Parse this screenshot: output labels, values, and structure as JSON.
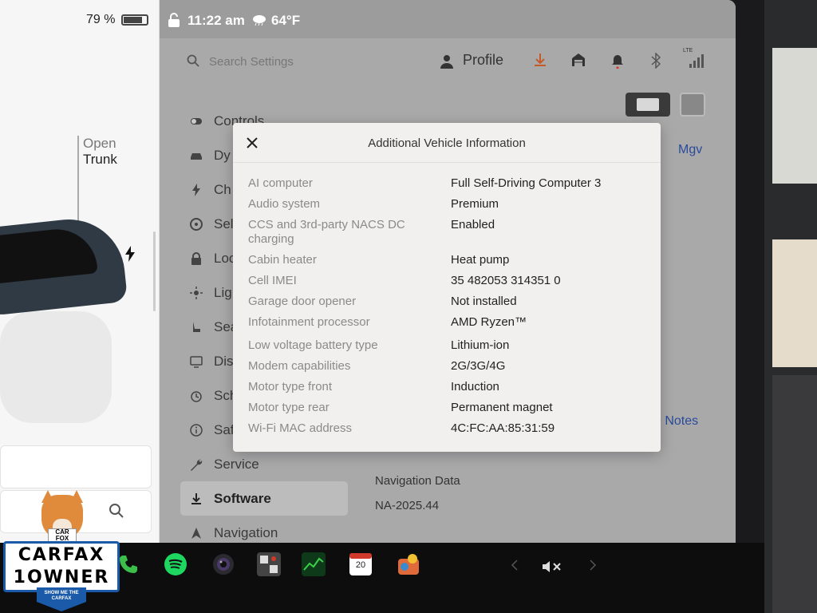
{
  "status": {
    "battery_percent_text": "79 %",
    "battery_level": 0.79,
    "time": "11:22 am",
    "temperature": "64°F",
    "weather_icon": "cloud-rain-icon"
  },
  "car_panel": {
    "open_label": "Open",
    "trunk_label": "Trunk"
  },
  "header": {
    "search_placeholder": "Search Settings",
    "profile_label": "Profile",
    "lte_label": "LTE"
  },
  "menu": {
    "items": [
      {
        "label": "Controls",
        "icon": "toggle-icon"
      },
      {
        "label": "Dy",
        "icon": "car-icon"
      },
      {
        "label": "Ch",
        "icon": "bolt-icon"
      },
      {
        "label": "Sel",
        "icon": "steering-wheel-icon"
      },
      {
        "label": "Loc",
        "icon": "lock-icon"
      },
      {
        "label": "Lig",
        "icon": "sun-icon"
      },
      {
        "label": "Sea",
        "icon": "seat-icon"
      },
      {
        "label": "Dis",
        "icon": "display-icon"
      },
      {
        "label": "Sch",
        "icon": "clock-icon"
      },
      {
        "label": "Saf",
        "icon": "info-icon"
      },
      {
        "label": "Service",
        "icon": "wrench-icon"
      },
      {
        "label": "Software",
        "icon": "download-icon"
      },
      {
        "label": "Navigation",
        "icon": "navigation-icon"
      }
    ],
    "active_index": 11
  },
  "background_content": {
    "mgv": "Mgv",
    "release_notes": "e Notes",
    "navigation_data_label": "Navigation Data",
    "navigation_data_value": "NA-2025.44"
  },
  "modal": {
    "title": "Additional Vehicle Information",
    "rows": [
      {
        "label": "AI computer",
        "value": "Full Self-Driving Computer 3"
      },
      {
        "label": "Audio system",
        "value": "Premium"
      },
      {
        "label": "CCS and 3rd-party NACS DC charging",
        "value": "Enabled"
      },
      {
        "label": "Cabin heater",
        "value": "Heat pump"
      },
      {
        "label": "Cell IMEI",
        "value": "35 482053 314351 0"
      },
      {
        "label": "Garage door opener",
        "value": "Not installed"
      },
      {
        "label": "Infotainment processor",
        "value": "AMD Ryzen™"
      },
      {
        "label": "Low voltage battery type",
        "value": "Lithium-ion"
      },
      {
        "label": "Modem capabilities",
        "value": "2G/3G/4G"
      },
      {
        "label": "Motor type front",
        "value": "Induction"
      },
      {
        "label": "Motor type rear",
        "value": "Permanent magnet"
      },
      {
        "label": "Wi-Fi MAC address",
        "value": "4C:FC:AA:85:31:59"
      }
    ]
  },
  "dock": {
    "calendar_day": "20",
    "apps": [
      "phone-icon",
      "spotify-icon",
      "camera-icon",
      "arcade-icon",
      "stocks-icon",
      "calendar-icon",
      "toybox-icon"
    ]
  },
  "carfax": {
    "shirt_line1": "CAR",
    "shirt_line2": "FOX",
    "line1": "CARFAX",
    "line2": "1OWNER",
    "ribbon_line1": "SHOW ME THE",
    "ribbon_line2": "CARFAX"
  },
  "colors": {
    "link": "#2a4a9a",
    "modal_bg": "#f1f0ee",
    "dim_overlay": "#a9a9aa",
    "carfax_blue": "#1a5aa8"
  }
}
